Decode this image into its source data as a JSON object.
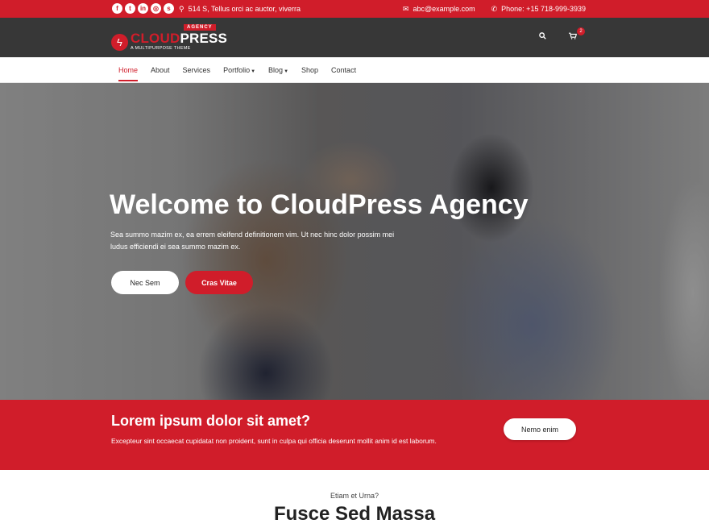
{
  "topbar": {
    "social_icons": [
      "facebook-icon",
      "twitter-icon",
      "linkedin-icon",
      "instagram-icon",
      "skype-icon"
    ],
    "social_glyphs": [
      "f",
      "t",
      "in",
      "◎",
      "s"
    ],
    "address": "514 S, Tellus orci ac auctor, viverra",
    "email": "abc@example.com",
    "phone": "Phone: +15 718-999-3939"
  },
  "header": {
    "logo_part1": "CLOUD",
    "logo_part2": "PRESS",
    "logo_tag": "AGENCY",
    "logo_subtitle": "A MULTIPURPOSE THEME",
    "cart_count": "2"
  },
  "nav": {
    "items": [
      "Home",
      "About",
      "Services",
      "Portfolio",
      "Blog",
      "Shop",
      "Contact"
    ]
  },
  "hero": {
    "title": "Welcome to CloudPress Agency",
    "text": "Sea summo mazim ex, ea errem eleifend definitionem vim. Ut nec hinc dolor possim mei ludus efficiendi ei sea summo mazim ex.",
    "button1": "Nec Sem",
    "button2": "Cras Vitae"
  },
  "cta": {
    "title": "Lorem ipsum dolor sit amet?",
    "text": "Excepteur sint occaecat cupidatat non proident, sunt in culpa qui officia deserunt mollit anim id est laborum.",
    "button": "Nemo enim"
  },
  "section": {
    "subtitle": "Etiam et Urna?",
    "title": "Fusce Sed Massa"
  },
  "colors": {
    "accent": "#d01d2a",
    "header_bg": "#373737"
  }
}
